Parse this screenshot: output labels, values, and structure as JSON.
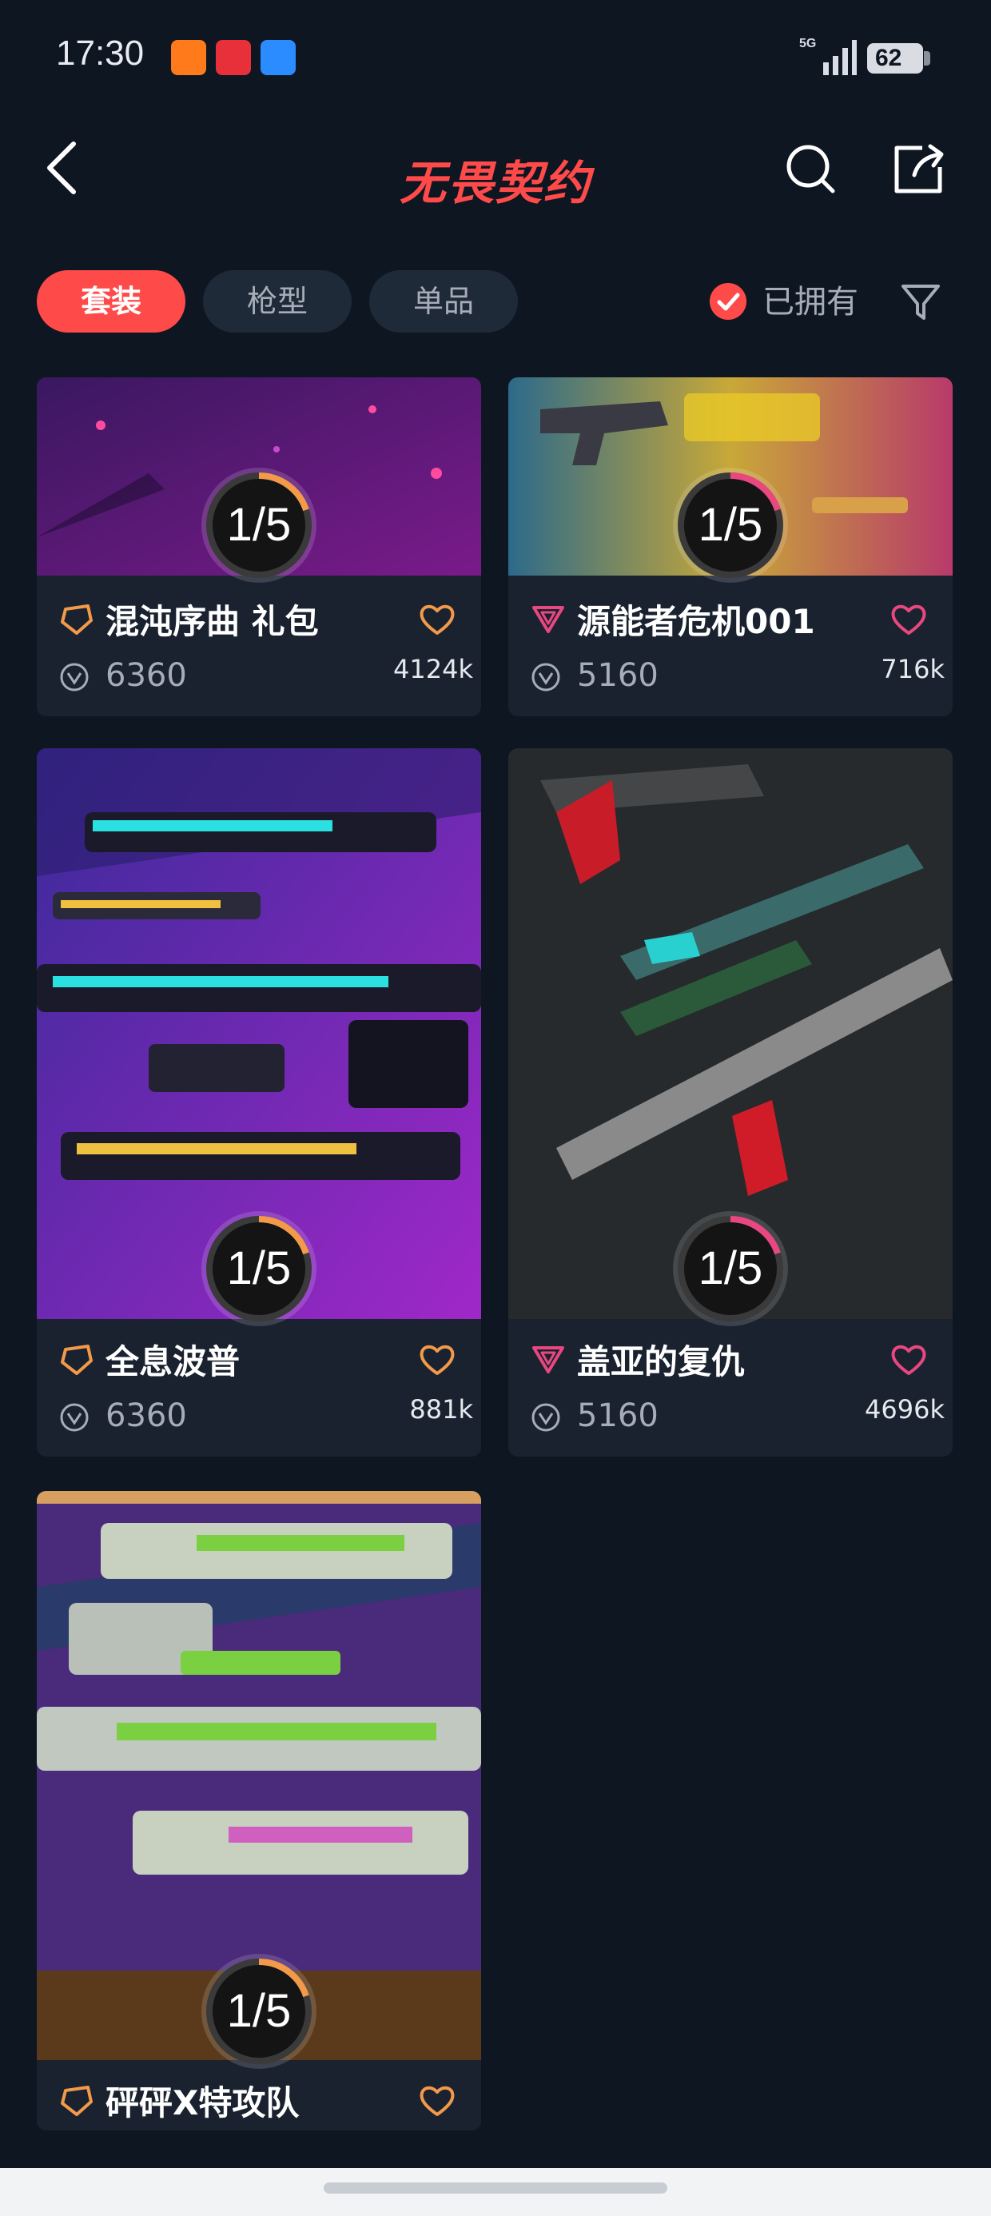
{
  "status_bar": {
    "time": "17:30",
    "network": "5G",
    "battery": "62",
    "app_icons": [
      "app-icon-orange",
      "app-icon-red",
      "app-icon-blue"
    ]
  },
  "header": {
    "title": "无畏契约",
    "back_icon": "chevron-left-icon",
    "search_icon": "search-icon",
    "share_icon": "share-icon"
  },
  "filters": {
    "tabs": [
      {
        "label": "套装",
        "active": true
      },
      {
        "label": "枪型",
        "active": false
      },
      {
        "label": "单品",
        "active": false
      }
    ],
    "owned_label": "已拥有",
    "owned_checked": true,
    "filter_icon": "filter-icon"
  },
  "colors": {
    "accent": "#ff4a4a",
    "background": "#0e1622",
    "card": "#1a2230",
    "premium_tier": "#f39a4a",
    "deluxe_tier": "#e8477f"
  },
  "cards": [
    {
      "name": "混沌序曲 礼包",
      "price": "6360",
      "likes": "4124k",
      "progress": "1/5",
      "progress_fraction": 0.2,
      "tier": "premium"
    },
    {
      "name": "源能者危机001",
      "price": "5160",
      "likes": "716k",
      "progress": "1/5",
      "progress_fraction": 0.2,
      "tier": "deluxe"
    },
    {
      "name": "全息波普",
      "price": "6360",
      "likes": "881k",
      "progress": "1/5",
      "progress_fraction": 0.2,
      "tier": "premium"
    },
    {
      "name": "盖亚的复仇",
      "price": "5160",
      "likes": "4696k",
      "progress": "1/5",
      "progress_fraction": 0.2,
      "tier": "deluxe"
    },
    {
      "name": "砰砰X特攻队",
      "price": "",
      "likes": "",
      "progress": "1/5",
      "progress_fraction": 0.2,
      "tier": "premium"
    }
  ]
}
